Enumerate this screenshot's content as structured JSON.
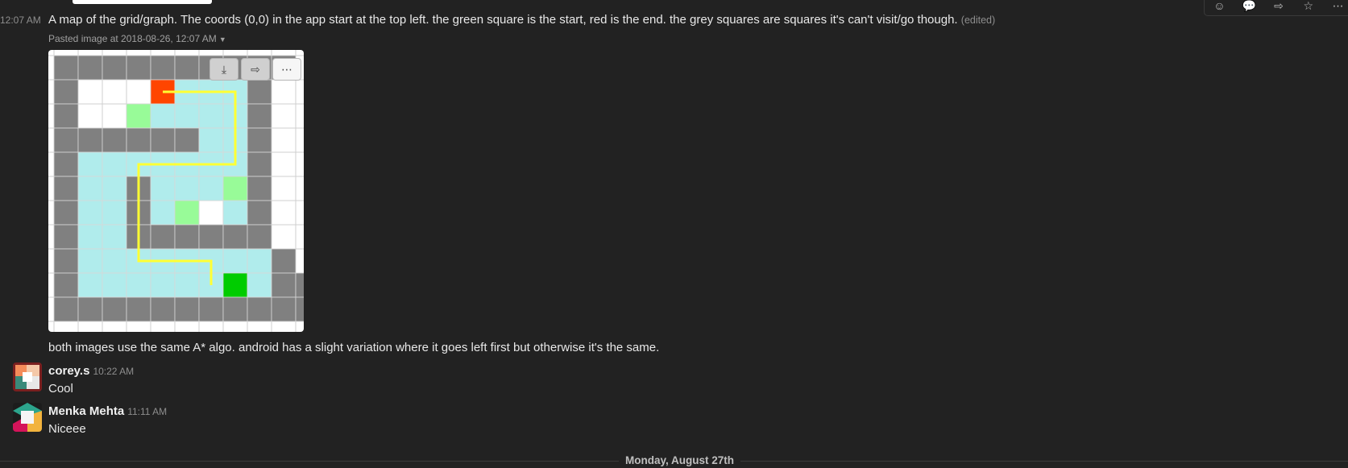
{
  "message1": {
    "timestamp": "12:07 AM",
    "text": "A map of the grid/graph. The coords (0,0) in the app start at the top left. the green square is the start, red is the end. the grey squares are squares it's can't visit/go though.",
    "edited": "(edited)",
    "meta": "Pasted image at 2018-08-26, 12:07 AM"
  },
  "message_actions": [
    "emoji-icon",
    "thread-icon",
    "share-icon",
    "star-icon",
    "more-icon"
  ],
  "file_actions": [
    "download-icon",
    "share-icon",
    "more-icon"
  ],
  "grid": {
    "colors": {
      "wall": "#808080",
      "open": "#b0ecec",
      "white": "#ffffff",
      "start": "#00cc00",
      "end": "#ff4500",
      "explored": "#98fb98",
      "path": "#ffff33"
    },
    "cells": [
      "WWWWWWWWWWO",
      "WOOOEAAAWOO",
      "WOOXAAAAWOO",
      "WWWWWWAAWOO",
      "WAAAAAAAWOO",
      "WAAWAAAXWOO",
      "WAAWAXOAWOO",
      "WAAWWWWWWOO",
      "WAAAAAAAAWO",
      "WAAAAAASAWW",
      "WWWWWWWWWWW"
    ],
    "path": [
      [
        4.5,
        1.5
      ],
      [
        7.5,
        1.5
      ],
      [
        7.5,
        4.5
      ],
      [
        3.5,
        4.5
      ],
      [
        3.5,
        8.5
      ],
      [
        6.5,
        8.5
      ],
      [
        6.5,
        9.5
      ]
    ]
  },
  "message2": {
    "text": "both images use the same A* algo. android has a slight variation where it goes left first but otherwise it's the same."
  },
  "message3": {
    "user": "corey.s",
    "time": "10:22 AM",
    "text": "Cool"
  },
  "message4": {
    "user": "Menka Mehta",
    "time": "11:11 AM",
    "text": "Niceee"
  },
  "day_divider": "Monday, August 27th"
}
